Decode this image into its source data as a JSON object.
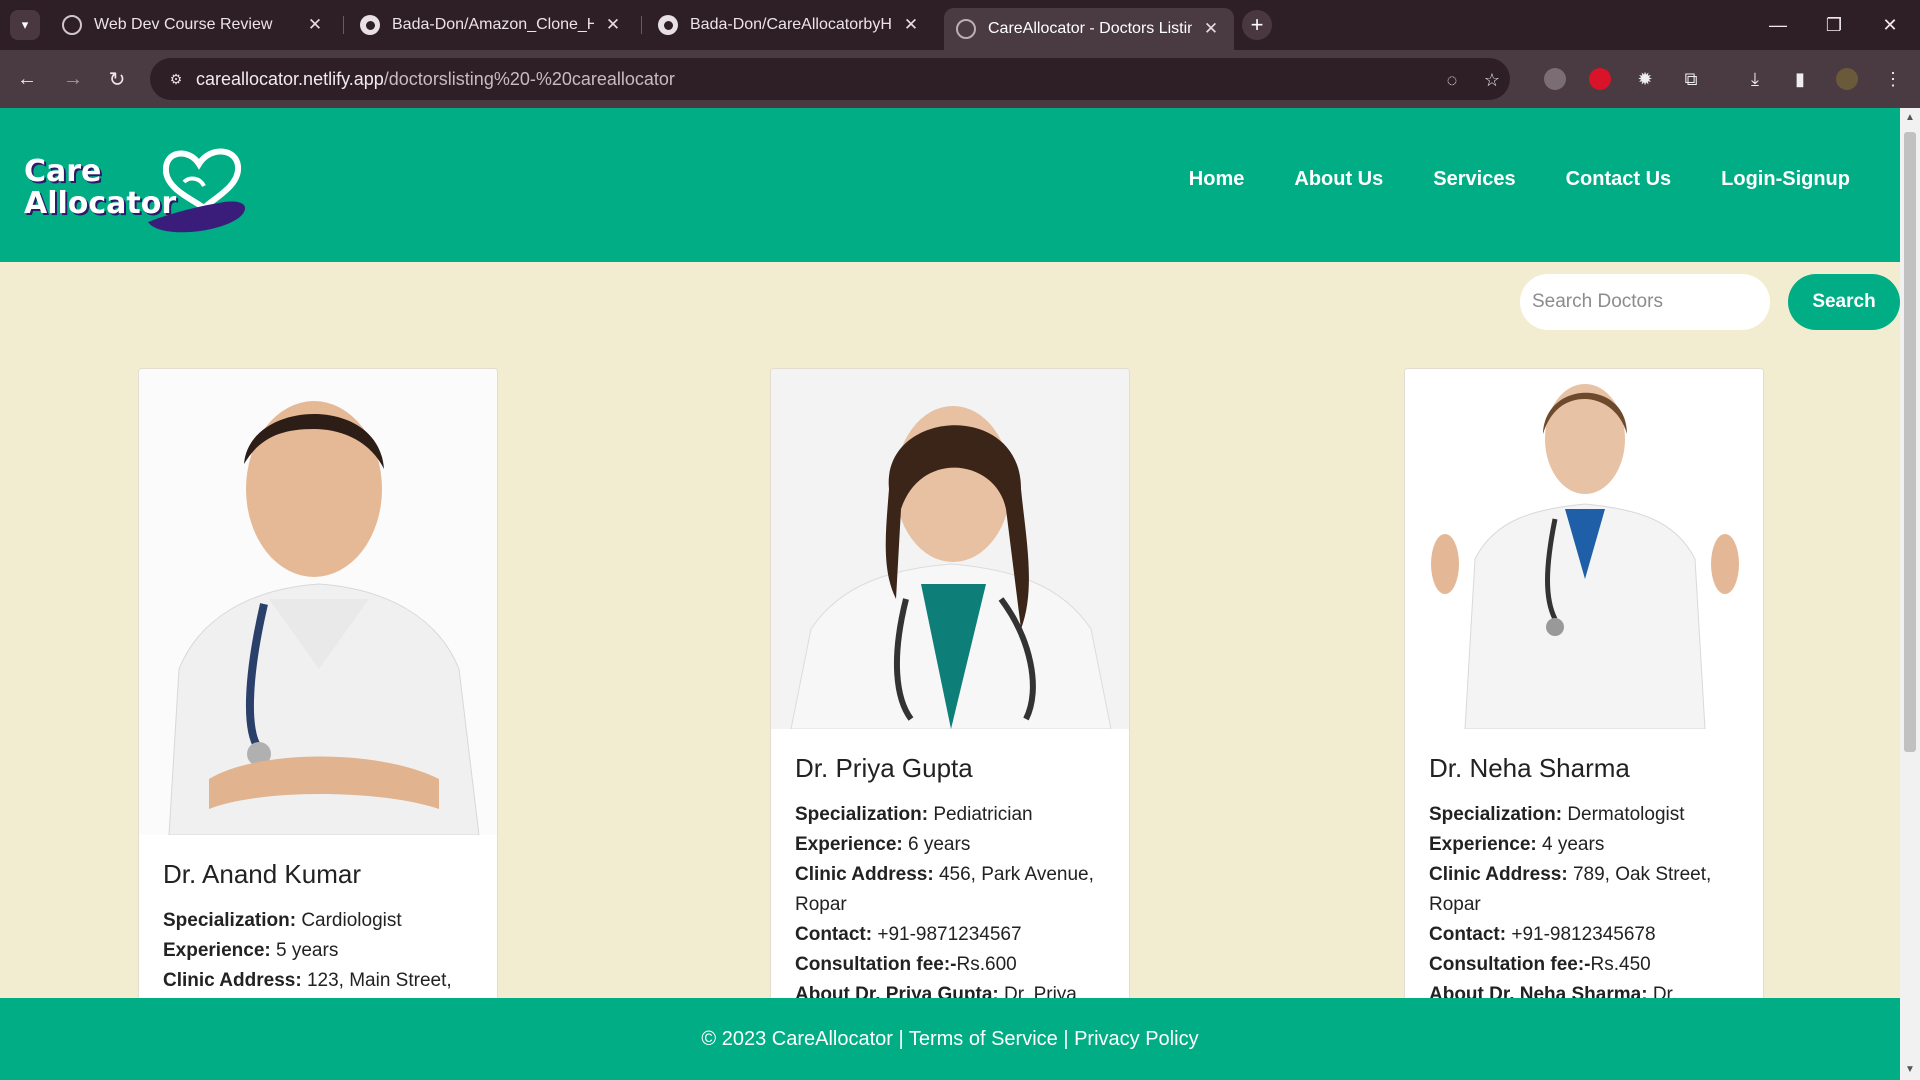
{
  "browser": {
    "tabs": [
      {
        "title": "Web Dev Course Review",
        "icon": "openai-icon"
      },
      {
        "title": "Bada-Don/Amazon_Clone_Har",
        "icon": "github-icon"
      },
      {
        "title": "Bada-Don/CareAllocatorbyHar",
        "icon": "github-icon"
      },
      {
        "title": "CareAllocator - Doctors Listing",
        "icon": "globe-icon"
      }
    ],
    "url_host": "careallocator.netlify.app",
    "url_path": "/doctorslisting%20-%20careallocator"
  },
  "site": {
    "logo_line1": "Care",
    "logo_line2": "Allocator",
    "nav": [
      "Home",
      "About Us",
      "Services",
      "Contact Us",
      "Login-Signup"
    ],
    "search_placeholder": "Search Doctors",
    "search_button": "Search",
    "footer": "© 2023 CareAllocator | Terms of Service | Privacy Policy",
    "colors": {
      "primary": "#00ad85",
      "background": "#f2ecd0",
      "logo_purple": "#2b1a6b"
    }
  },
  "doctors": [
    {
      "name": "Dr. Anand Kumar",
      "specialization_label": "Specialization:",
      "specialization": "Cardiologist",
      "experience_label": "Experience:",
      "experience": "5 years",
      "address_label": "Clinic Address:",
      "address": "123, Main Street,"
    },
    {
      "name": "Dr. Priya Gupta",
      "specialization_label": "Specialization:",
      "specialization": "Pediatrician",
      "experience_label": "Experience:",
      "experience": "6 years",
      "address_label": "Clinic Address:",
      "address": "456, Park Avenue, Ropar",
      "contact_label": "Contact:",
      "contact": "+91-9871234567",
      "fee_label": "Consultation fee:-",
      "fee": "Rs.600",
      "about_label": "About Dr. Priya Gupta:",
      "about": "Dr. Priya"
    },
    {
      "name": "Dr. Neha Sharma",
      "specialization_label": "Specialization:",
      "specialization": "Dermatologist",
      "experience_label": "Experience:",
      "experience": "4 years",
      "address_label": "Clinic Address:",
      "address": "789, Oak Street, Ropar",
      "contact_label": "Contact:",
      "contact": "+91-9812345678",
      "fee_label": "Consultation fee:-",
      "fee": "Rs.450",
      "about_label": "About Dr. Neha Sharma:",
      "about": "Dr."
    }
  ]
}
